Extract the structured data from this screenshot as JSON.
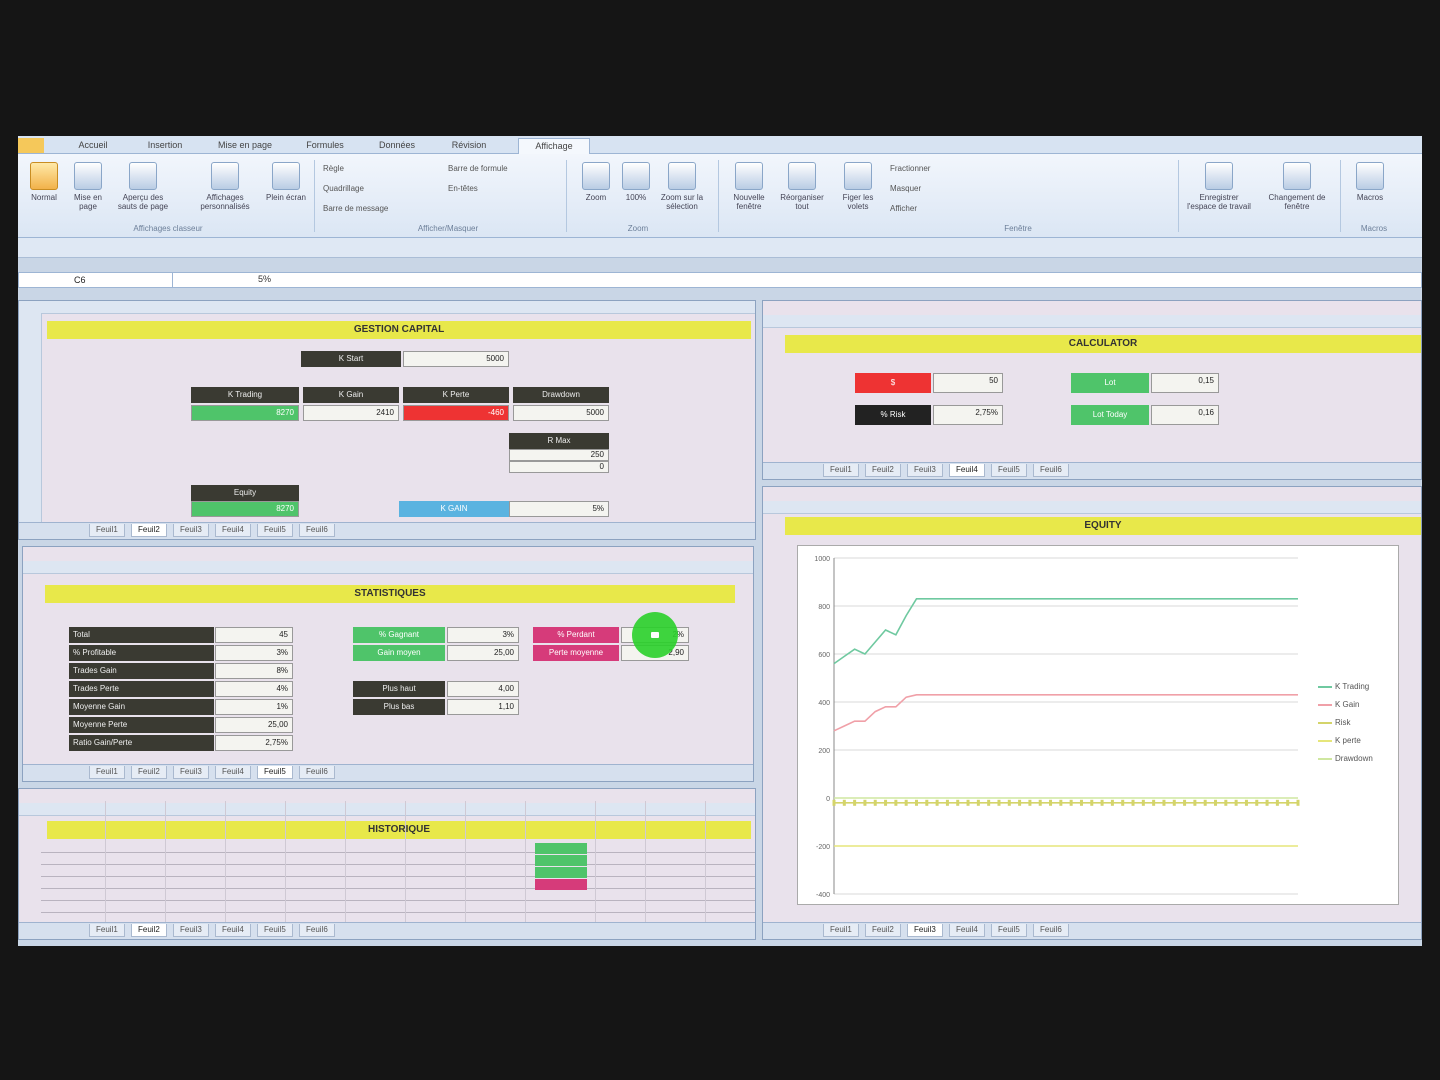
{
  "app": {
    "ribbon_tabs": [
      "Accueil",
      "Insertion",
      "Mise en page",
      "Formules",
      "Données",
      "Révision",
      "Affichage"
    ],
    "active_tab": "Affichage",
    "name_box": "C6",
    "formula_value": "5%",
    "ribbon_buttons": [
      {
        "label": "Normal",
        "icon": "normal-view-icon"
      },
      {
        "label": "Mise en page",
        "icon": "page-layout-icon"
      },
      {
        "label": "Aperçu des sauts de page",
        "icon": "page-break-icon"
      },
      {
        "label": "Affichages personnalisés",
        "icon": "custom-views-icon"
      },
      {
        "label": "Plein écran",
        "icon": "full-screen-icon"
      },
      {
        "label": "Zoom",
        "icon": "zoom-icon"
      },
      {
        "label": "100%",
        "icon": "zoom-100-icon"
      },
      {
        "label": "Zoom sur la sélection",
        "icon": "zoom-selection-icon"
      },
      {
        "label": "Nouvelle fenêtre",
        "icon": "new-window-icon"
      },
      {
        "label": "Réorganiser tout",
        "icon": "arrange-all-icon"
      },
      {
        "label": "Figer les volets",
        "icon": "freeze-panes-icon"
      },
      {
        "label": "Enregistrer l'espace de travail",
        "icon": "save-workspace-icon"
      },
      {
        "label": "Changement de fenêtre",
        "icon": "switch-window-icon"
      },
      {
        "label": "Macros",
        "icon": "macros-icon"
      }
    ],
    "ribbon_checks": [
      "Règle",
      "Quadrillage",
      "Barre de message",
      "Barre de formule",
      "En-têtes",
      "Fractionner",
      "Masquer",
      "Afficher"
    ],
    "ribbon_groups": [
      "Affichages classeur",
      "Afficher/Masquer",
      "Zoom",
      "Fenêtre",
      "Macros"
    ]
  },
  "sheet_tabs": [
    "Feuil1",
    "Feuil2",
    "Feuil3",
    "Feuil4",
    "Feuil5",
    "Feuil6"
  ],
  "capital": {
    "title": "GESTION CAPITAL",
    "capital_label": "K Start",
    "capital_value": "5000",
    "headers": [
      "K Trading",
      "K Gain",
      "K Perte",
      "Drawdown"
    ],
    "values": [
      "8270",
      "2410",
      "-460",
      "5000"
    ],
    "risk_label": "R Max",
    "risk_values": [
      "250",
      "0"
    ],
    "equity_label": "Equity",
    "equity_value": "8270",
    "kgain_label": "K GAIN",
    "kgain_value": "5%"
  },
  "calculator": {
    "title": "CALCULATOR",
    "cells": [
      {
        "label": "$",
        "value": "50",
        "style": "red"
      },
      {
        "label": "% Risk",
        "value": "2,75%",
        "style": "black"
      },
      {
        "label": "Lot",
        "value": "0,15",
        "style": "green"
      },
      {
        "label": "Lot Today",
        "value": "0,16",
        "style": "green"
      }
    ]
  },
  "stats": {
    "title": "STATISTIQUES",
    "rows": [
      {
        "label": "Total",
        "value": "45"
      },
      {
        "label": "% Profitable",
        "value": "3%"
      },
      {
        "label": "Trades Gain",
        "value": "8%"
      },
      {
        "label": "Trades Perte",
        "value": "4%"
      },
      {
        "label": "Moyenne Gain",
        "value": "1%"
      },
      {
        "label": "Moyenne Perte",
        "value": "25,00"
      },
      {
        "label": "Ratio Gain/Perte",
        "value": "2,75%"
      }
    ],
    "right_cells": [
      {
        "label": "% Gagnant",
        "value": "3%",
        "style": "green"
      },
      {
        "label": "Gain moyen",
        "value": "25,00",
        "style": "green"
      },
      {
        "label": "% Perdant",
        "value": "2%",
        "style": "pink"
      },
      {
        "label": "Perte moyenne",
        "value": "2,90",
        "style": "pink"
      },
      {
        "label": "Plus haut",
        "value": "4,00",
        "style": "dark"
      },
      {
        "label": "Plus bas",
        "value": "1,10",
        "style": "dark"
      }
    ]
  },
  "history": {
    "title": "HISTORIQUE"
  },
  "equity_chart": {
    "title": "EQUITY"
  },
  "chart_data": {
    "type": "line",
    "title": "EQUITY",
    "xlabel": "",
    "ylabel": "",
    "ylim": [
      -400,
      1000
    ],
    "y_ticks": [
      "1000",
      "800",
      "600",
      "400",
      "200",
      "0",
      "-200",
      "-400"
    ],
    "x": [
      1,
      2,
      3,
      4,
      5,
      6,
      7,
      8,
      9,
      10,
      11,
      12,
      13,
      14,
      15,
      16,
      17,
      18,
      19,
      20,
      21,
      22,
      23,
      24,
      25,
      26,
      27,
      28,
      29,
      30,
      31,
      32,
      33,
      34,
      35,
      36,
      37,
      38,
      39,
      40,
      41,
      42,
      43,
      44,
      45,
      46
    ],
    "series": [
      {
        "name": "K Trading",
        "color": "#6fc9a0",
        "values": [
          560,
          590,
          620,
          600,
          650,
          700,
          680,
          760,
          830,
          830,
          830,
          830,
          830,
          830,
          830,
          830,
          830,
          830,
          830,
          830,
          830,
          830,
          830,
          830,
          830,
          830,
          830,
          830,
          830,
          830,
          830,
          830,
          830,
          830,
          830,
          830,
          830,
          830,
          830,
          830,
          830,
          830,
          830,
          830,
          830,
          830
        ]
      },
      {
        "name": "K Gain",
        "color": "#f0a0a8",
        "values": [
          280,
          300,
          320,
          320,
          360,
          380,
          380,
          420,
          430,
          430,
          430,
          430,
          430,
          430,
          430,
          430,
          430,
          430,
          430,
          430,
          430,
          430,
          430,
          430,
          430,
          430,
          430,
          430,
          430,
          430,
          430,
          430,
          430,
          430,
          430,
          430,
          430,
          430,
          430,
          430,
          430,
          430,
          430,
          430,
          430,
          430
        ]
      },
      {
        "name": "Risk",
        "color": "#d4d46a",
        "values": [
          -20,
          -20,
          -20,
          -20,
          -20,
          -20,
          -20,
          -20,
          -20,
          -20,
          -20,
          -20,
          -20,
          -20,
          -20,
          -20,
          -20,
          -20,
          -20,
          -20,
          -20,
          -20,
          -20,
          -20,
          -20,
          -20,
          -20,
          -20,
          -20,
          -20,
          -20,
          -20,
          -20,
          -20,
          -20,
          -20,
          -20,
          -20,
          -20,
          -20,
          -20,
          -20,
          -20,
          -20,
          -20,
          -20
        ]
      },
      {
        "name": "K perte",
        "color": "#e6e67a",
        "values": [
          -200,
          -200,
          -200,
          -200,
          -200,
          -200,
          -200,
          -200,
          -200,
          -200,
          -200,
          -200,
          -200,
          -200,
          -200,
          -200,
          -200,
          -200,
          -200,
          -200,
          -200,
          -200,
          -200,
          -200,
          -200,
          -200,
          -200,
          -200,
          -200,
          -200,
          -200,
          -200,
          -200,
          -200,
          -200,
          -200,
          -200,
          -200,
          -200,
          -200,
          -200,
          -200,
          -200,
          -200,
          -200,
          -200
        ]
      },
      {
        "name": "Drawdown",
        "color": "#cfe7a0",
        "values": [
          0,
          0,
          0,
          0,
          0,
          0,
          0,
          0,
          0,
          0,
          0,
          0,
          0,
          0,
          0,
          0,
          0,
          0,
          0,
          0,
          0,
          0,
          0,
          0,
          0,
          0,
          0,
          0,
          0,
          0,
          0,
          0,
          0,
          0,
          0,
          0,
          0,
          0,
          0,
          0,
          0,
          0,
          0,
          0,
          0,
          0
        ]
      }
    ],
    "grid": true,
    "legend": "right"
  }
}
